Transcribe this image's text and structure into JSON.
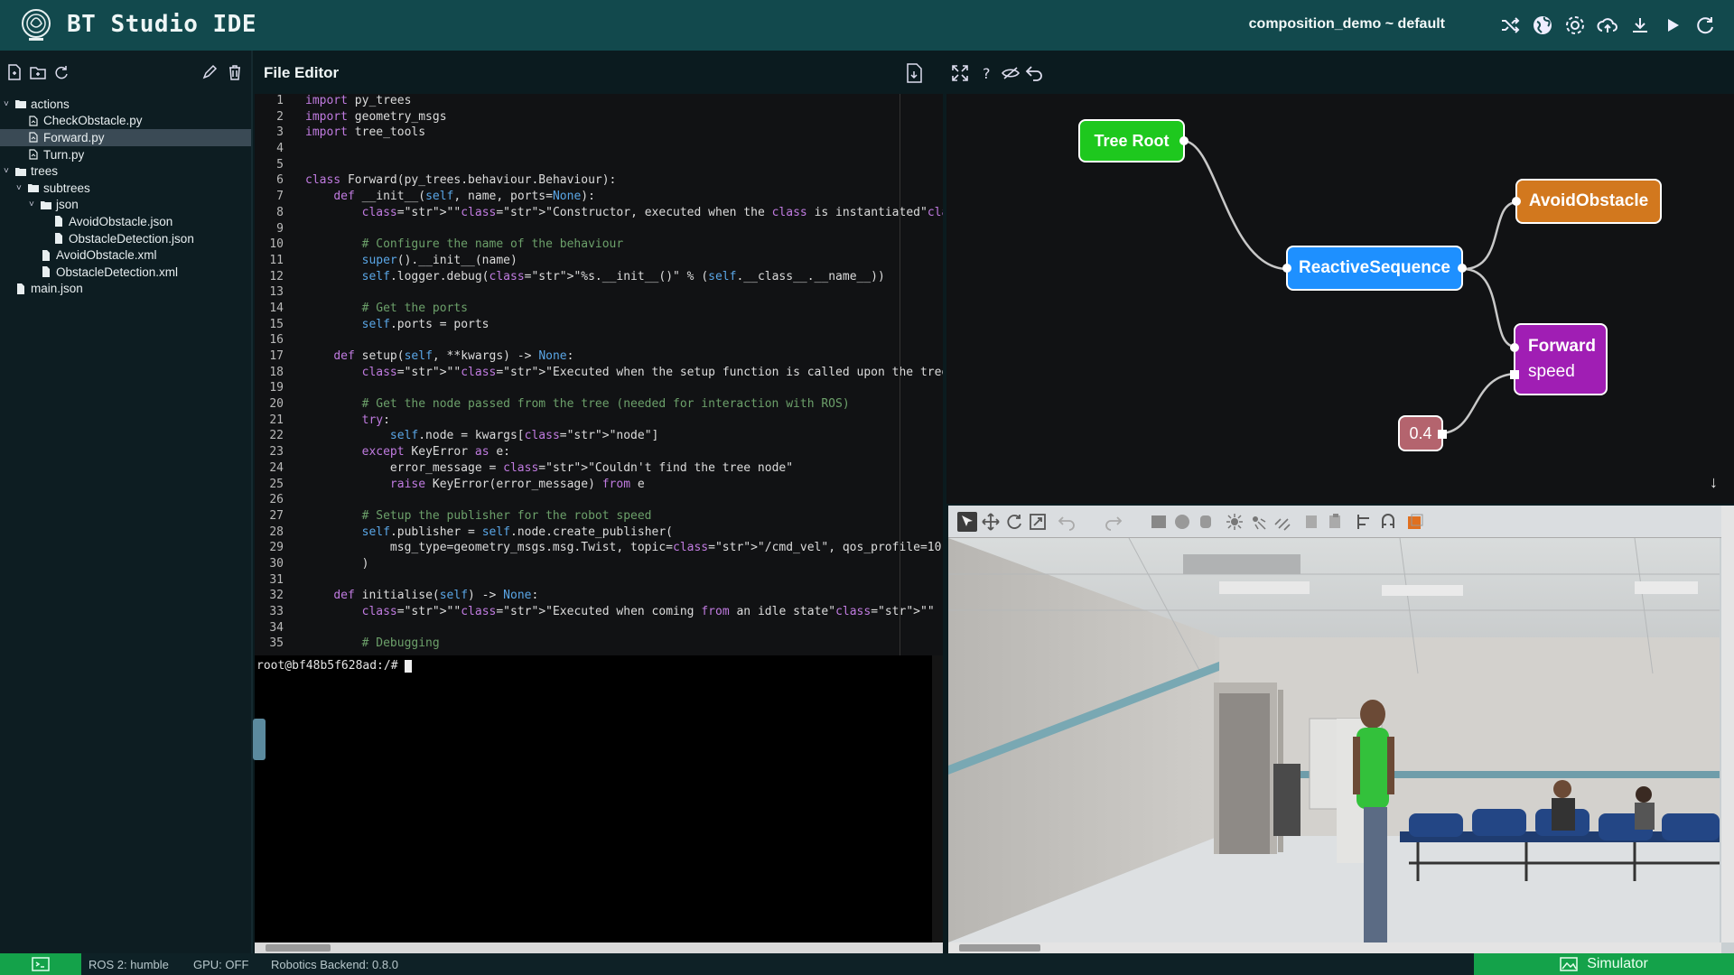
{
  "header": {
    "title": "BT Studio IDE",
    "project": "composition_demo ~ default",
    "icons": [
      "shuffle-icon",
      "globe-icon",
      "settings-icon",
      "cloud-upload-icon",
      "download-icon",
      "play-icon",
      "refresh-icon"
    ]
  },
  "sidebar": {
    "toolbar_icons": [
      "new-file-icon",
      "new-folder-icon",
      "refresh-icon",
      "rename-icon",
      "delete-icon"
    ],
    "tree": [
      {
        "label": "actions",
        "type": "folder",
        "depth": 0,
        "open": true
      },
      {
        "label": "CheckObstacle.py",
        "type": "py",
        "depth": 1
      },
      {
        "label": "Forward.py",
        "type": "py",
        "depth": 1,
        "selected": true
      },
      {
        "label": "Turn.py",
        "type": "py",
        "depth": 1
      },
      {
        "label": "trees",
        "type": "folder",
        "depth": 0,
        "open": true
      },
      {
        "label": "subtrees",
        "type": "folder",
        "depth": 1,
        "open": true
      },
      {
        "label": "json",
        "type": "folder",
        "depth": 2,
        "open": true
      },
      {
        "label": "AvoidObstacle.json",
        "type": "file",
        "depth": 3
      },
      {
        "label": "ObstacleDetection.json",
        "type": "file",
        "depth": 3
      },
      {
        "label": "AvoidObstacle.xml",
        "type": "file",
        "depth": 2
      },
      {
        "label": "ObstacleDetection.xml",
        "type": "file",
        "depth": 2
      },
      {
        "label": "main.json",
        "type": "file",
        "depth": 0
      }
    ]
  },
  "editor": {
    "title": "File Editor",
    "zoom_in": "+",
    "zoom_out": "-",
    "lines": [
      "import py_trees",
      "import geometry_msgs",
      "import tree_tools",
      "",
      "",
      "class Forward(py_trees.behaviour.Behaviour):",
      "    def __init__(self, name, ports=None):",
      "        \"\"\"Constructor, executed when the class is instantiated\"\"\"",
      "",
      "        # Configure the name of the behaviour",
      "        super().__init__(name)",
      "        self.logger.debug(\"%s.__init__()\" % (self.__class__.__name__))",
      "",
      "        # Get the ports",
      "        self.ports = ports",
      "",
      "    def setup(self, **kwargs) -> None:",
      "        \"\"\"Executed when the setup function is called upon the tree\"\"\"",
      "",
      "        # Get the node passed from the tree (needed for interaction with ROS)",
      "        try:",
      "            self.node = kwargs[\"node\"]",
      "        except KeyError as e:",
      "            error_message = \"Couldn't find the tree node\"",
      "            raise KeyError(error_message) from e",
      "",
      "        # Setup the publisher for the robot speed",
      "        self.publisher = self.node.create_publisher(",
      "            msg_type=geometry_msgs.msg.Twist, topic=\"/cmd_vel\", qos_profile=10",
      "        )",
      "",
      "    def initialise(self) -> None:",
      "        \"\"\"Executed when coming from an idle state\"\"\"",
      "",
      "        # Debugging"
    ]
  },
  "terminal": {
    "prompt": "root@bf48b5f628ad:/# "
  },
  "tree_canvas": {
    "toolbar_icons": [
      "fullscreen-icon",
      "help-icon",
      "hide-icon",
      "return-icon"
    ],
    "nodes": {
      "root": "Tree Root",
      "sequence": "ReactiveSequence",
      "avoid": "AvoidObstacle",
      "forward": "Forward",
      "forward_port": "speed",
      "value": "0.4"
    },
    "colors": {
      "root": "#1ec81e",
      "sequence": "#1e90ff",
      "avoid": "#d2781e",
      "forward": "#a01eb4",
      "value": "#b4646e"
    }
  },
  "status": {
    "ros": "ROS 2: humble",
    "gpu": "GPU: OFF",
    "backend": "Robotics Backend: 0.8.0",
    "simulator": "Simulator"
  }
}
